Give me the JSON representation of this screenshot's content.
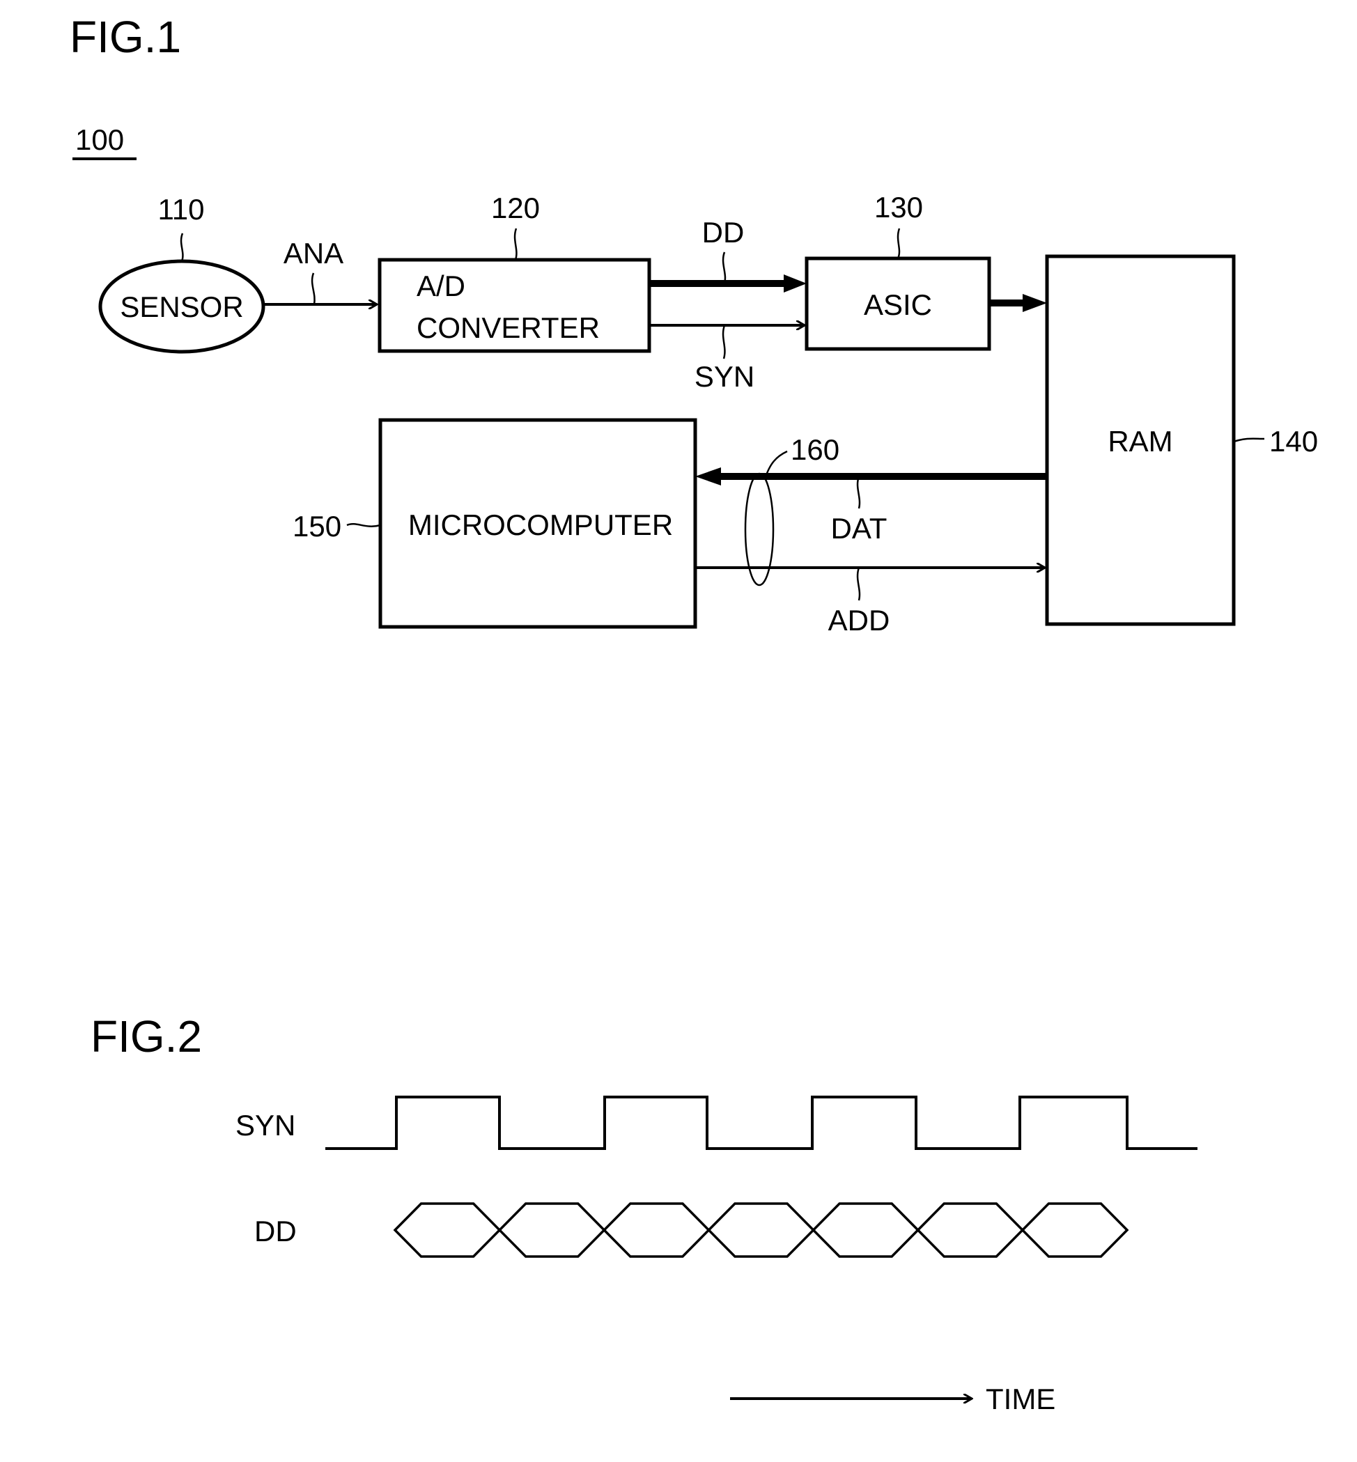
{
  "fig1": {
    "title": "FIG.1",
    "system_ref": "100",
    "blocks": {
      "sensor": {
        "label": "SENSOR",
        "ref": "110"
      },
      "adc": {
        "label_line1": "A/D",
        "label_line2": "CONVERTER",
        "ref": "120"
      },
      "asic": {
        "label": "ASIC",
        "ref": "130"
      },
      "ram": {
        "label": "RAM",
        "ref": "140"
      },
      "micro": {
        "label": "MICROCOMPUTER",
        "ref": "150"
      }
    },
    "signals": {
      "ana": "ANA",
      "dd": "DD",
      "syn": "SYN",
      "dat": "DAT",
      "add": "ADD",
      "bus_ref": "160"
    }
  },
  "fig2": {
    "title": "FIG.2",
    "syn_label": "SYN",
    "dd_label": "DD",
    "time_label": "TIME",
    "syn_levels": [
      0,
      1,
      0,
      1,
      0,
      1,
      0,
      1,
      0
    ],
    "dd_cells": 7
  }
}
